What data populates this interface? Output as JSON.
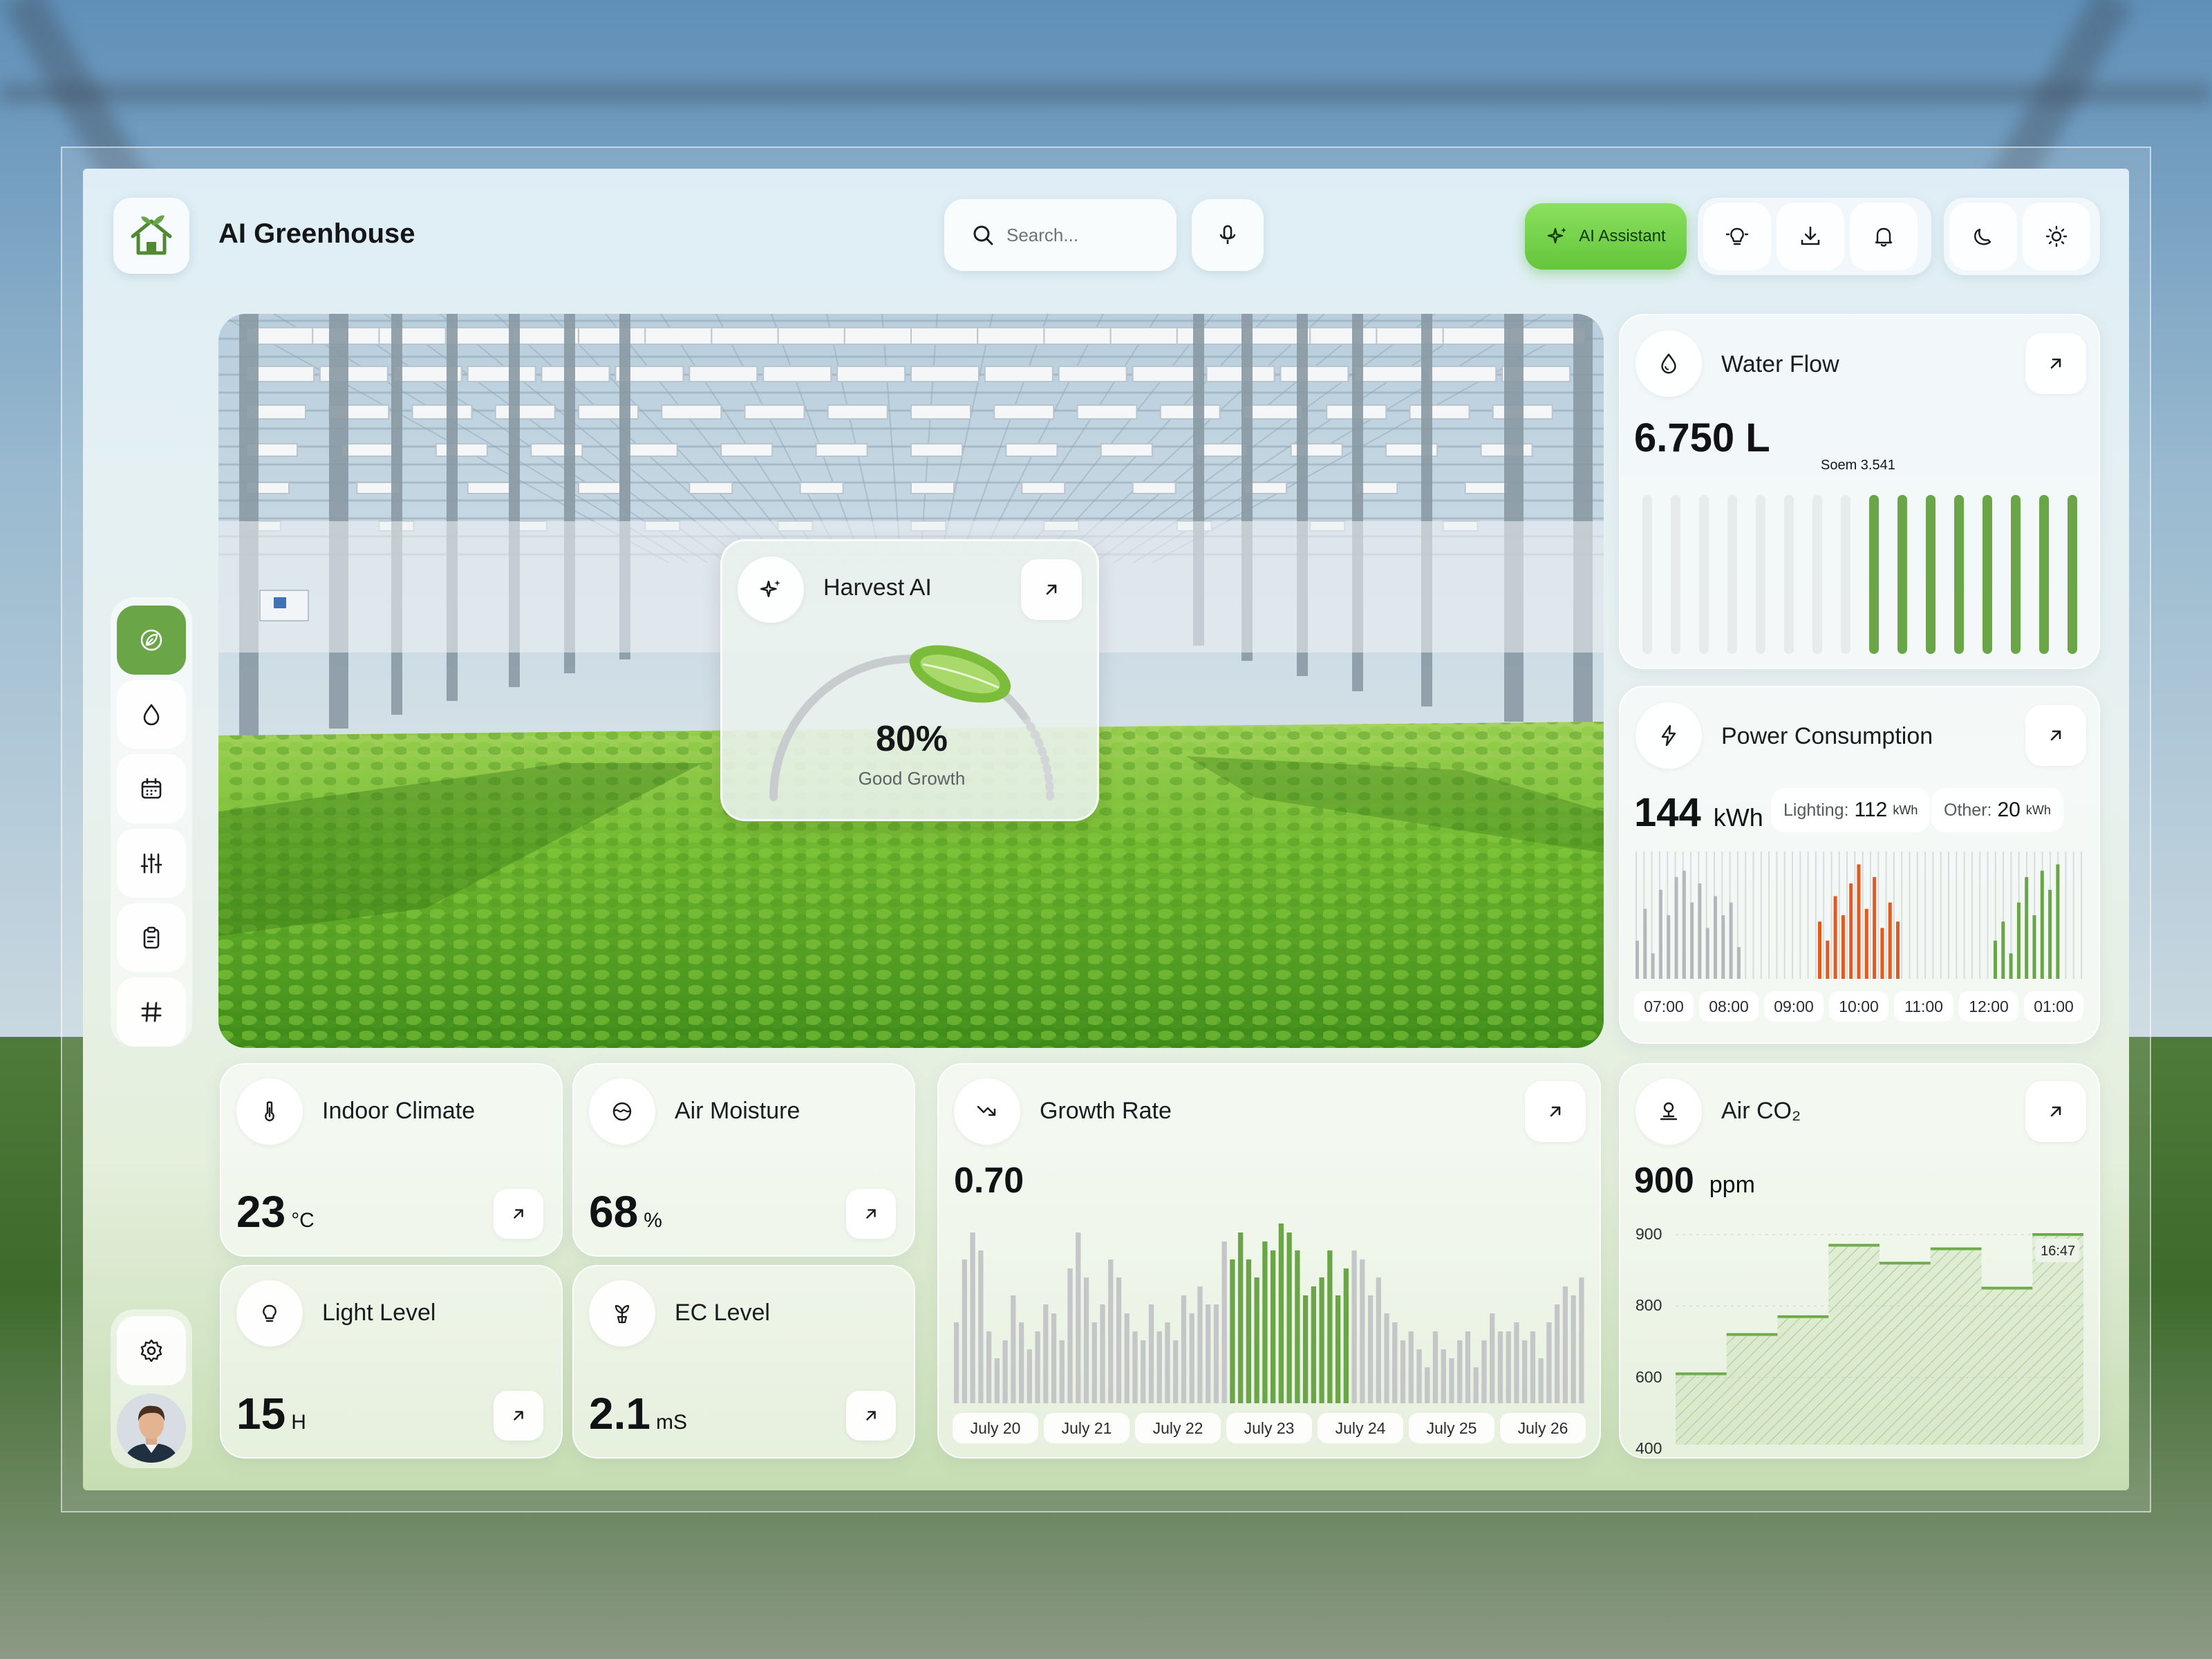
{
  "app": {
    "title": "AI Greenhouse"
  },
  "header": {
    "search_placeholder": "Search...",
    "ai_assistant_label": "AI Assistant",
    "icons": [
      "lightbulb-icon",
      "download-icon",
      "bell-icon",
      "moon-icon",
      "sun-icon"
    ]
  },
  "sidebar": {
    "items": [
      "leaf-icon",
      "water-drop-icon",
      "calendar-icon",
      "sliders-icon",
      "clipboard-icon",
      "hash-icon"
    ],
    "active": 0,
    "bottom": [
      "settings-icon",
      "avatar"
    ]
  },
  "harvest": {
    "title": "Harvest AI",
    "value": "80%",
    "status": "Good Growth",
    "progress": 0.8
  },
  "water_flow": {
    "title": "Water Flow",
    "value": "6.750 L",
    "tooltip": "Soem 3.541",
    "bars_total": 16,
    "bars_active_from": 8
  },
  "power": {
    "title": "Power Consumption",
    "value": "144",
    "unit": "kWh",
    "lighting_label": "Lighting:",
    "lighting_value": "112",
    "lighting_unit": "kWh",
    "other_label": "Other:",
    "other_value": "20",
    "other_unit": "kWh",
    "ticks": [
      "07:00",
      "08:00",
      "09:00",
      "10:00",
      "11:00",
      "12:00",
      "01:00"
    ],
    "colors": {
      "gray": "#b5b8ba",
      "orange": "#e35a1e",
      "green": "#6aa648"
    }
  },
  "indoor_climate": {
    "title": "Indoor Climate",
    "value": "23",
    "unit": "°C"
  },
  "air_moisture": {
    "title": "Air Moisture",
    "value": "68",
    "unit": "%"
  },
  "light_level": {
    "title": "Light Level",
    "value": "15",
    "unit": "H"
  },
  "ec_level": {
    "title": "EC Level",
    "value": "2.1",
    "unit": "mS"
  },
  "growth_rate": {
    "title": "Growth Rate",
    "value": "0.70",
    "dates": [
      "July 20",
      "July 21",
      "July 22",
      "July 23",
      "July 24",
      "July 25",
      "July 26"
    ]
  },
  "co2": {
    "title": "Air CO₂",
    "value": "900",
    "unit": "ppm",
    "tooltip": "16:47",
    "y_ticks": [
      "900",
      "800",
      "600",
      "400"
    ]
  },
  "chart_data": [
    {
      "type": "bar",
      "title": "Water Flow",
      "values": [
        0.92,
        0.92,
        0.92,
        0.92,
        0.92,
        0.92,
        0.92,
        0.92,
        0.92,
        0.92,
        0.92,
        0.92,
        0.92,
        0.92,
        0.92,
        0.92
      ],
      "highlighted_from_index": 8,
      "ylim": [
        0,
        1
      ]
    },
    {
      "type": "bar",
      "title": "Power Consumption",
      "categories": [
        "07:00",
        "08:00",
        "09:00",
        "10:00",
        "11:00",
        "12:00",
        "01:00"
      ],
      "series": [
        {
          "values": [
            0.3,
            0.55,
            0.2,
            0.7,
            0.5,
            0.8,
            0.85,
            0.6,
            0.75,
            0.4,
            0.65,
            0.5,
            0.6,
            0.25,
            0.0,
            0.0,
            0.0,
            0.0,
            0.0,
            0.0,
            0.0,
            0.0,
            0.0,
            0.0,
            0.0,
            0.0,
            0.0,
            0.0,
            0.0,
            0.0,
            0.0,
            0.0,
            0.0,
            0.0,
            0.0,
            0.0,
            0.0,
            0.0,
            0.0,
            0.0,
            0.0,
            0.0,
            0.0,
            0.0,
            0.0,
            0.0,
            0.0,
            0.0,
            0.0,
            0.0,
            0.0,
            0.0,
            0.0,
            0.0,
            0.0,
            0.0,
            0.0,
            0.0
          ]
        },
        {
          "values": [
            0.45,
            0.3,
            0.65,
            0.5,
            0.75,
            0.9,
            0.55,
            0.8,
            0.4,
            0.6,
            0.45
          ]
        },
        {
          "values": [
            0.3,
            0.45,
            0.2,
            0.6,
            0.8,
            0.5,
            0.85,
            0.7,
            0.9
          ]
        }
      ]
    },
    {
      "type": "bar",
      "title": "Growth Rate",
      "categories": [
        "July 20",
        "July 21",
        "July 22",
        "July 23",
        "July 24",
        "July 25",
        "July 26"
      ],
      "values": [
        0.45,
        0.8,
        0.95,
        0.85,
        0.4,
        0.25,
        0.35,
        0.6,
        0.45,
        0.3,
        0.4,
        0.55,
        0.5,
        0.35,
        0.75,
        0.95,
        0.7,
        0.45,
        0.55,
        0.8,
        0.7,
        0.5,
        0.4,
        0.35,
        0.55,
        0.4,
        0.45,
        0.35,
        0.6,
        0.5,
        0.65,
        0.55,
        0.55,
        0.9,
        0.8,
        0.95,
        0.8,
        0.7,
        0.9,
        0.85,
        1.0,
        0.95,
        0.85,
        0.6,
        0.65,
        0.7,
        0.85,
        0.6,
        0.75,
        0.85,
        0.8,
        0.6,
        0.7,
        0.5,
        0.45,
        0.35,
        0.4,
        0.3,
        0.2,
        0.4,
        0.3,
        0.25,
        0.35,
        0.4,
        0.2,
        0.35,
        0.5,
        0.4,
        0.4,
        0.45,
        0.35,
        0.4,
        0.25,
        0.45,
        0.55,
        0.65,
        0.6,
        0.7
      ],
      "highlighted_range": [
        34,
        48
      ]
    },
    {
      "type": "area",
      "title": "Air CO₂",
      "values": [
        610,
        720,
        770,
        885,
        860,
        880,
        825,
        900
      ],
      "ylim": [
        400,
        900
      ],
      "y_ticks": [
        900,
        800,
        600,
        400
      ]
    }
  ]
}
